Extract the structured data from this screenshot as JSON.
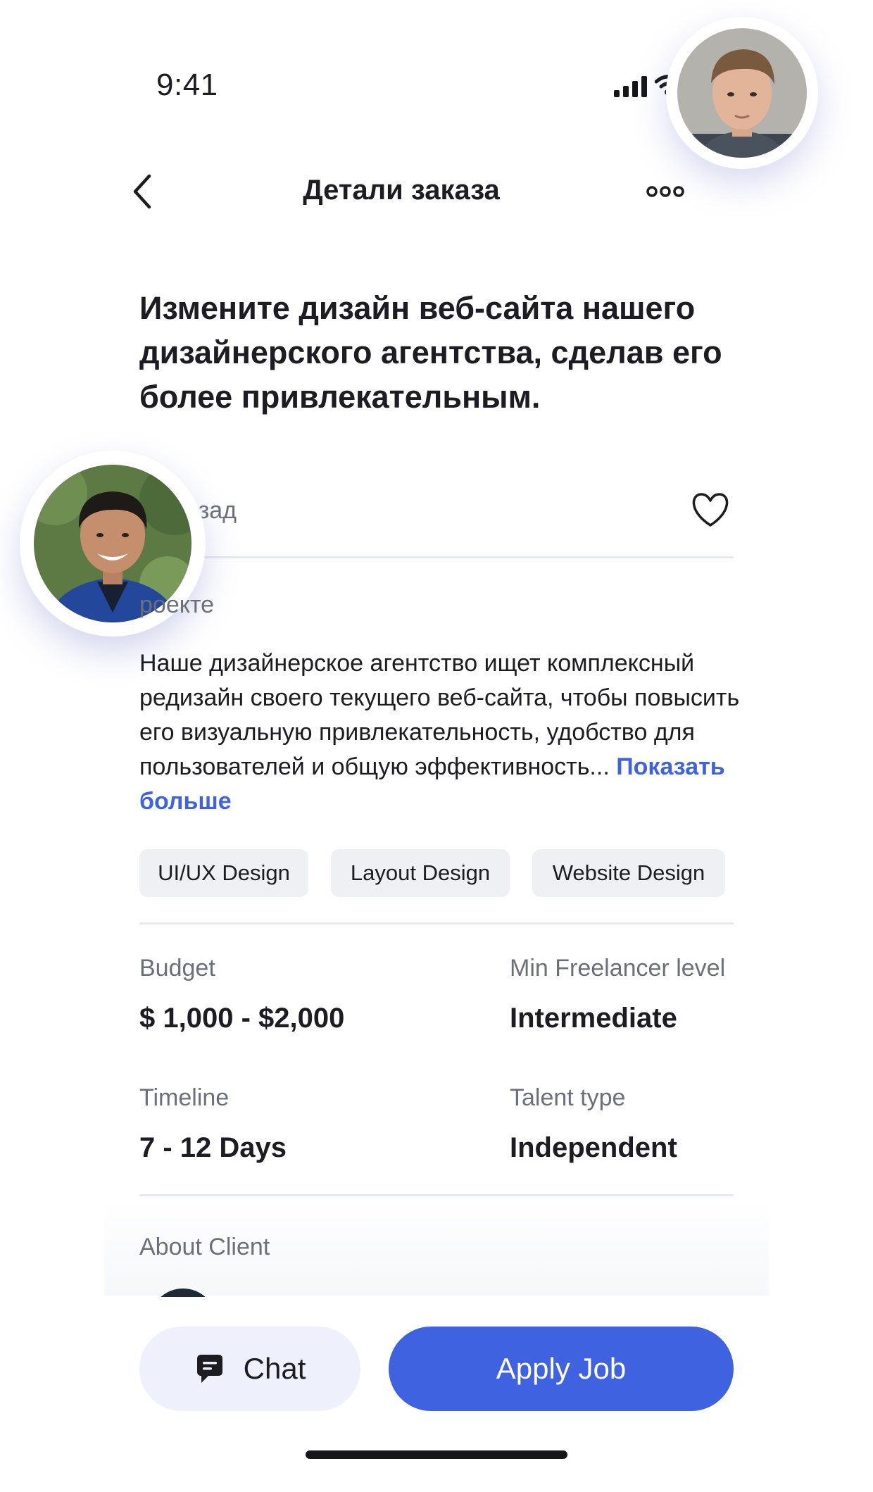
{
  "status_bar": {
    "time": "9:41"
  },
  "header": {
    "title": "Детали заказа",
    "back_icon": "chevron-left-icon",
    "more_icon": "more-horizontal-icon"
  },
  "job": {
    "title": "Измените дизайн веб-сайта нашего дизайнерского агентства, сделав его более привлекательным.",
    "posted": "ов назад",
    "about_label": "роекте",
    "description": "Наше дизайнерское агентство ищет комплексный редизайн своего текущего веб-сайта, чтобы повысить его визуальную привлекательность, удобство для пользователей и общую эффективность...",
    "show_more": "Показать больше",
    "tags": [
      "UI/UX Design",
      "Layout Design",
      "Website Design"
    ]
  },
  "details": {
    "budget_label": "Budget",
    "budget_value": "$ 1,000 - $2,000",
    "level_label": "Min Freelancer level",
    "level_value": "Intermediate",
    "timeline_label": "Timeline",
    "timeline_value": "7 - 12 Days",
    "talent_label": "Talent type",
    "talent_value": "Independent"
  },
  "client": {
    "label": "About Client"
  },
  "actions": {
    "chat_label": "Chat",
    "apply_label": "Apply Job"
  },
  "colors": {
    "accent": "#3f63e0",
    "chat_bg": "#eef1fb",
    "tag_bg": "#eef0f3"
  }
}
